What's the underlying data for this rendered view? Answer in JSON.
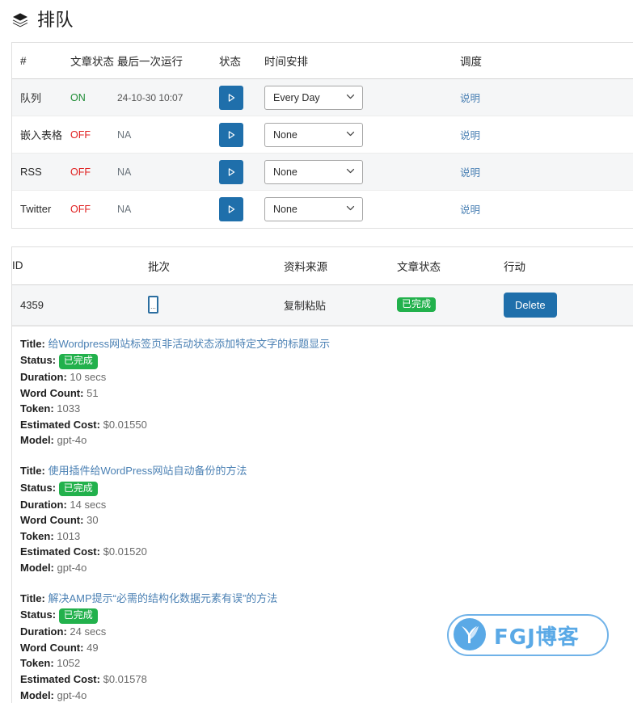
{
  "header": {
    "icon": "layers-icon",
    "title": "排队"
  },
  "schedule_table": {
    "columns": [
      "#",
      "文章状态",
      "最后一次运行",
      "状态",
      "时间安排",
      "调度"
    ],
    "rows": [
      {
        "name": "队列",
        "post_status": "ON",
        "last_run": "24-10-30 10:07",
        "run_button": "run-icon",
        "schedule": "Every Day",
        "desc_link": "说明"
      },
      {
        "name": "嵌入表格",
        "post_status": "OFF",
        "last_run": "NA",
        "run_button": "run-icon",
        "schedule": "None",
        "desc_link": "说明"
      },
      {
        "name": "RSS",
        "post_status": "OFF",
        "last_run": "NA",
        "run_button": "run-icon",
        "schedule": "None",
        "desc_link": "说明"
      },
      {
        "name": "Twitter",
        "post_status": "OFF",
        "last_run": "NA",
        "run_button": "run-icon",
        "schedule": "None",
        "desc_link": "说明"
      }
    ]
  },
  "jobs_table": {
    "columns": [
      "ID",
      "批次",
      "资料来源",
      "文章状态",
      "行动"
    ],
    "rows": [
      {
        "id": "4359",
        "batch": "...",
        "source": "复制粘贴",
        "post_status": "已完成",
        "action": "Delete"
      }
    ]
  },
  "details": {
    "labels": {
      "title": "Title:",
      "status": "Status:",
      "duration": "Duration:",
      "word_count": "Word Count:",
      "token": "Token:",
      "estimated_cost": "Estimated Cost:",
      "model": "Model:"
    },
    "items": [
      {
        "title": "给Wordpress网站标签页非活动状态添加特定文字的标题显示",
        "status": "已完成",
        "duration": "10 secs",
        "word_count": "51",
        "token": "1033",
        "estimated_cost": "$0.01550",
        "model": "gpt-4o"
      },
      {
        "title": "使用插件给WordPress网站自动备份的方法",
        "status": "已完成",
        "duration": "14 secs",
        "word_count": "30",
        "token": "1013",
        "estimated_cost": "$0.01520",
        "model": "gpt-4o"
      },
      {
        "title": "解决AMP提示“必需的结构化数据元素有误”的方法",
        "status": "已完成",
        "duration": "24 secs",
        "word_count": "49",
        "token": "1052",
        "estimated_cost": "$0.01578",
        "model": "gpt-4o"
      }
    ]
  },
  "watermark": {
    "text": "FGJ博客",
    "logo": "leaf-check-icon"
  },
  "colors": {
    "primary_blue": "#1f6fab",
    "link_blue": "#4b81b4",
    "success_green": "#22b14c",
    "on_green": "#1d8c34",
    "off_red": "#e02020",
    "watermark_blue": "#5aa9e6"
  }
}
